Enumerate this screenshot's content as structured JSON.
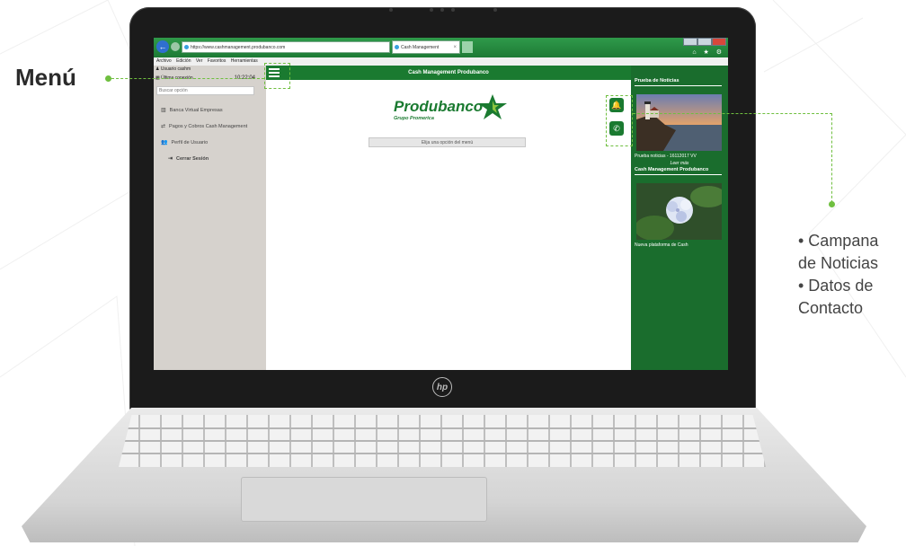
{
  "browser": {
    "url": "https://www.cashmanagement.produbanco.com",
    "url_tools": "⌕ ▾ ⟳",
    "tab_title": "Cash Management",
    "tab_close": "×",
    "top_icons": "⌂ ★ ⚙"
  },
  "menu_bar": {
    "items": [
      "Archivo",
      "Edición",
      "Ver",
      "Favoritos",
      "Herramientas"
    ]
  },
  "sidebar": {
    "user": "Usuario cashm",
    "last_connection_label": "Última conexión",
    "last_connection_time": "10:22:04",
    "search_placeholder": "Buscar opción",
    "items": [
      {
        "icon": "bank-icon",
        "label": "Banca Virtual Empresas"
      },
      {
        "icon": "transfer-icon",
        "label": "Pagos y Cobros Cash Management"
      },
      {
        "icon": "users-icon",
        "label": "Perfil de Usuario"
      }
    ],
    "logout": "Cerrar Sesión"
  },
  "header": {
    "title": "Cash Management Produbanco"
  },
  "main": {
    "brand_name": "Produbanco",
    "brand_sub": "Grupo Promerica",
    "choose_option": "Elija una opción del menú",
    "bell_icon": "bell-icon",
    "phone_icon": "phone-icon"
  },
  "news": {
    "heading": "Prueba de Noticias",
    "item1_caption": "Prueba noticias - 16112017 VV",
    "read_more": "Leer más",
    "heading2": "Cash Management Produbanco",
    "item2_caption": "Nueva plataforma de Cash"
  },
  "callouts": {
    "menu": "Menú",
    "right_lines": [
      "• Campana",
      "de Noticias",
      "• Datos de",
      "Contacto"
    ]
  },
  "colors": {
    "brand_green": "#1a7a30",
    "accent_green": "#6fbf3f"
  }
}
